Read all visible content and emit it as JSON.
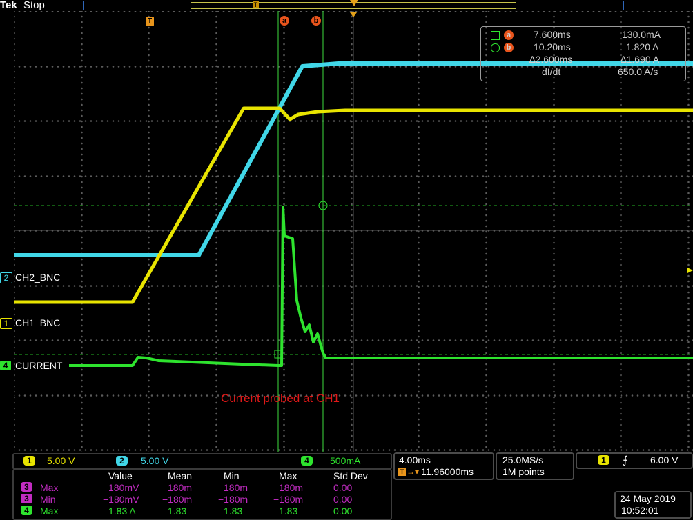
{
  "header": {
    "brand": "Tek",
    "status": "Stop",
    "trigger_marker": "T"
  },
  "cursors": {
    "a_label": "a",
    "b_label": "b",
    "panel": {
      "a_time": "7.600ms",
      "a_value": "130.0mA",
      "b_time": "10.20ms",
      "b_value": "1.820 A",
      "delta_time": "∆2.600ms",
      "delta_value": "∆1.690 A",
      "rate_label": "dI/dt",
      "rate_value": "650.0 A/s"
    }
  },
  "channel_labels": {
    "ch2": "CH2_BNC",
    "ch1": "CH1_BNC",
    "ch4": "CURRENT",
    "ch2_num": "2",
    "ch1_num": "1",
    "ch4_num": "4"
  },
  "annotation": "Current probed at CH1",
  "channel_bar": {
    "ch1_num": "1",
    "ch1_scale": "5.00 V",
    "ch2_num": "2",
    "ch2_scale": "5.00 V",
    "ch4_num": "4",
    "ch4_scale": "500mA"
  },
  "timebase": {
    "scale": "4.00ms",
    "position": "11.96000ms",
    "sample_rate": "25.0MS/s",
    "record_length": "1M points"
  },
  "trigger": {
    "source_num": "1",
    "slope_icon": "rising-edge-icon",
    "level": "6.00 V"
  },
  "measurements": {
    "headers": [
      "Value",
      "Mean",
      "Min",
      "Max",
      "Std Dev"
    ],
    "rows": [
      {
        "ch": "3",
        "name": "Max",
        "value": "180mV",
        "mean": "180m",
        "min": "180m",
        "max": "180m",
        "std": "0.00"
      },
      {
        "ch": "3",
        "name": "Min",
        "value": "−180mV",
        "mean": "−180m",
        "min": "−180m",
        "max": "−180m",
        "std": "0.00"
      },
      {
        "ch": "4",
        "name": "Max",
        "value": "1.83 A",
        "mean": "1.83",
        "min": "1.83",
        "max": "1.83",
        "std": "0.00"
      }
    ]
  },
  "datetime": {
    "date": "24 May 2019",
    "time": "10:52:01"
  },
  "colors": {
    "ch1": "#e8e400",
    "ch2": "#41d7e8",
    "ch3": "#c22cc2",
    "ch4": "#2ee32e",
    "cursor_marker": "#e8541c",
    "grid": "#5a5a5a"
  }
}
